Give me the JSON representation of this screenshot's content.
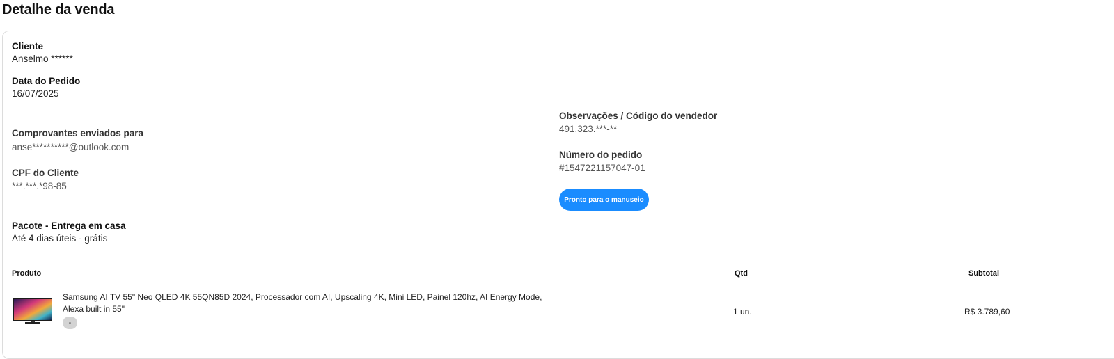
{
  "page": {
    "title": "Detalhe da venda"
  },
  "details": {
    "cliente": {
      "label": "Cliente",
      "value": "Anselmo ******"
    },
    "data_pedido": {
      "label": "Data do Pedido",
      "value": "16/07/2025"
    },
    "comprovantes": {
      "label": "Comprovantes enviados para",
      "value": "anse**********@outlook.com"
    },
    "cpf": {
      "label": "CPF do Cliente",
      "value": "***.***.*98-85"
    },
    "pacote": {
      "label": "Pacote - Entrega em casa",
      "value": "Até 4 dias úteis - grátis"
    },
    "observacoes": {
      "label": "Observações / Código do vendedor",
      "value": "491.323.***-**"
    },
    "numero_pedido": {
      "label": "Número do pedido",
      "value": "#1547221157047-01"
    }
  },
  "status_button": {
    "label": "Pronto para o manuseio"
  },
  "table": {
    "headers": {
      "produto": "Produto",
      "qtd": "Qtd",
      "subtotal": "Subtotal"
    },
    "rows": [
      {
        "name": "Samsung AI TV 55\" Neo QLED 4K 55QN85D 2024, Processador com AI, Upscaling 4K, Mini LED, Painel 120hz, AI Energy Mode, Alexa built in 55\"",
        "tag": "-",
        "qty": "1 un.",
        "subtotal": "R$ 3.789,60",
        "thumbnail_icon": "tv-product-image"
      }
    ]
  }
}
